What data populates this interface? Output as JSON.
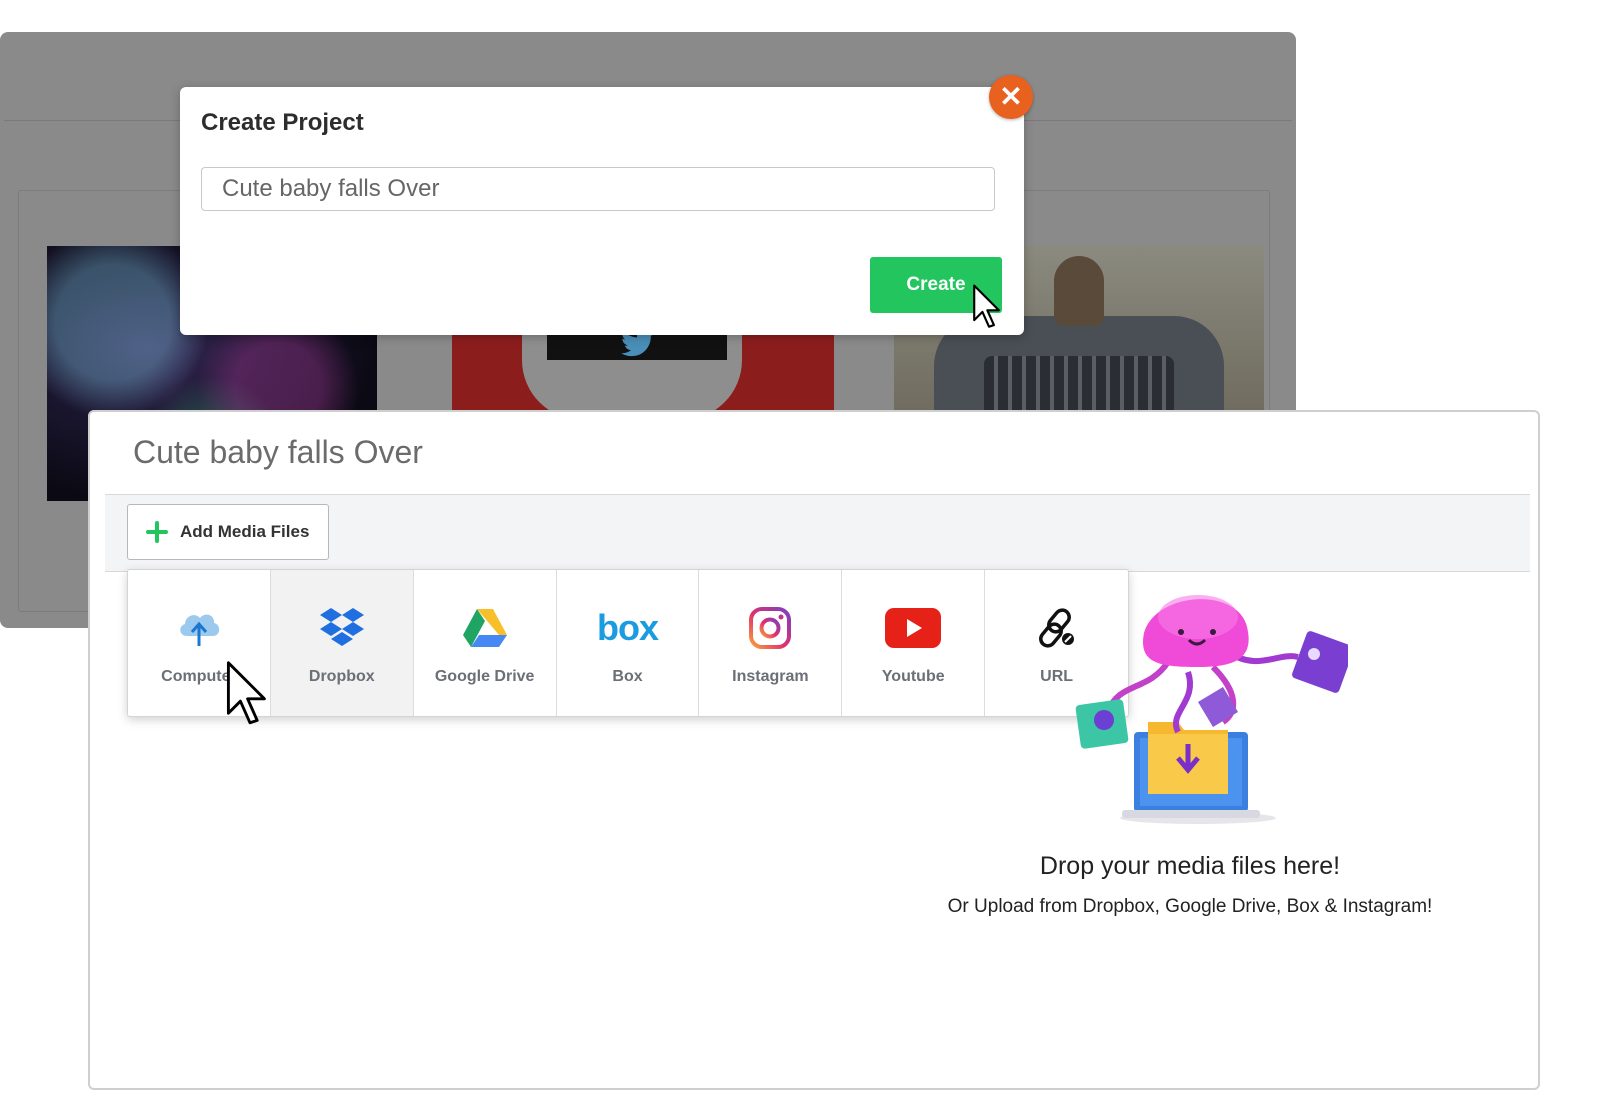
{
  "modal": {
    "title": "Create Project",
    "input_value": "Cute baby falls Over",
    "create_label": "Create",
    "close_glyph": "✕"
  },
  "project": {
    "title": "Cute baby falls Over",
    "add_media_label": "Add Media Files"
  },
  "sources": [
    {
      "label": "Computer",
      "icon": "cloud-upload-icon"
    },
    {
      "label": "Dropbox",
      "icon": "dropbox-icon"
    },
    {
      "label": "Google Drive",
      "icon": "google-drive-icon"
    },
    {
      "label": "Box",
      "icon": "box-icon"
    },
    {
      "label": "Instagram",
      "icon": "instagram-icon"
    },
    {
      "label": "Youtube",
      "icon": "youtube-icon"
    },
    {
      "label": "URL",
      "icon": "link-icon"
    }
  ],
  "box_logo_text": "box",
  "dropzone": {
    "title": "Drop your media files here!",
    "subtitle": "Or Upload from Dropbox, Google Drive, Box & Instagram!"
  },
  "colors": {
    "create_green": "#22c55e",
    "close_orange": "#e8611f",
    "dropbox_blue": "#1f6fe0",
    "box_blue": "#1b9be0",
    "youtube_red": "#e62117"
  }
}
